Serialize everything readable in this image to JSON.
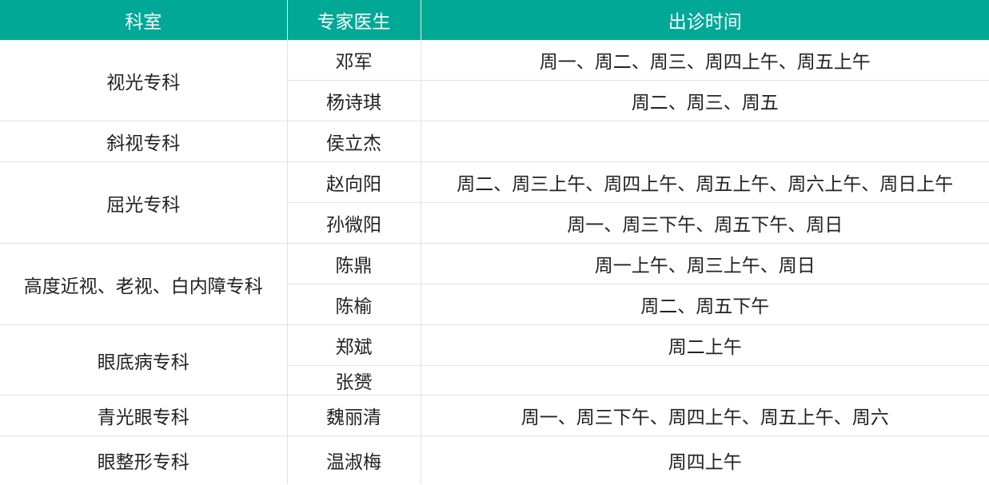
{
  "header": {
    "department": "科室",
    "doctor": "专家医生",
    "time": "出诊时间"
  },
  "rows": [
    {
      "department": "视光专科",
      "doctor": "邓军",
      "time": "周一、周二、周三、周四上午、周五上午"
    },
    {
      "department": "",
      "doctor": "杨诗琪",
      "time": "周二、周三、周五"
    },
    {
      "department": "斜视专科",
      "doctor": "侯立杰",
      "time": ""
    },
    {
      "department": "屈光专科",
      "doctor": "赵向阳",
      "time": "周二、周三上午、周四上午、周五上午、周六上午、周日上午"
    },
    {
      "department": "",
      "doctor": "孙微阳",
      "time": "周一、周三下午、周五下午、周日"
    },
    {
      "department": "高度近视、老视、白内障专科",
      "doctor": "陈鼎",
      "time": "周一上午、周三上午、周日"
    },
    {
      "department": "",
      "doctor": "陈榆",
      "time": "周二、周五下午"
    },
    {
      "department": "眼底病专科",
      "doctor": "郑斌",
      "time": "周二上午"
    },
    {
      "department": "",
      "doctor": "张赟",
      "time": ""
    },
    {
      "department": "青光眼专科",
      "doctor": "魏丽清",
      "time": "周一、周三下午、周四上午、周五上午、周六"
    },
    {
      "department": "眼整形专科",
      "doctor": "温淑梅",
      "time": "周四上午"
    }
  ]
}
